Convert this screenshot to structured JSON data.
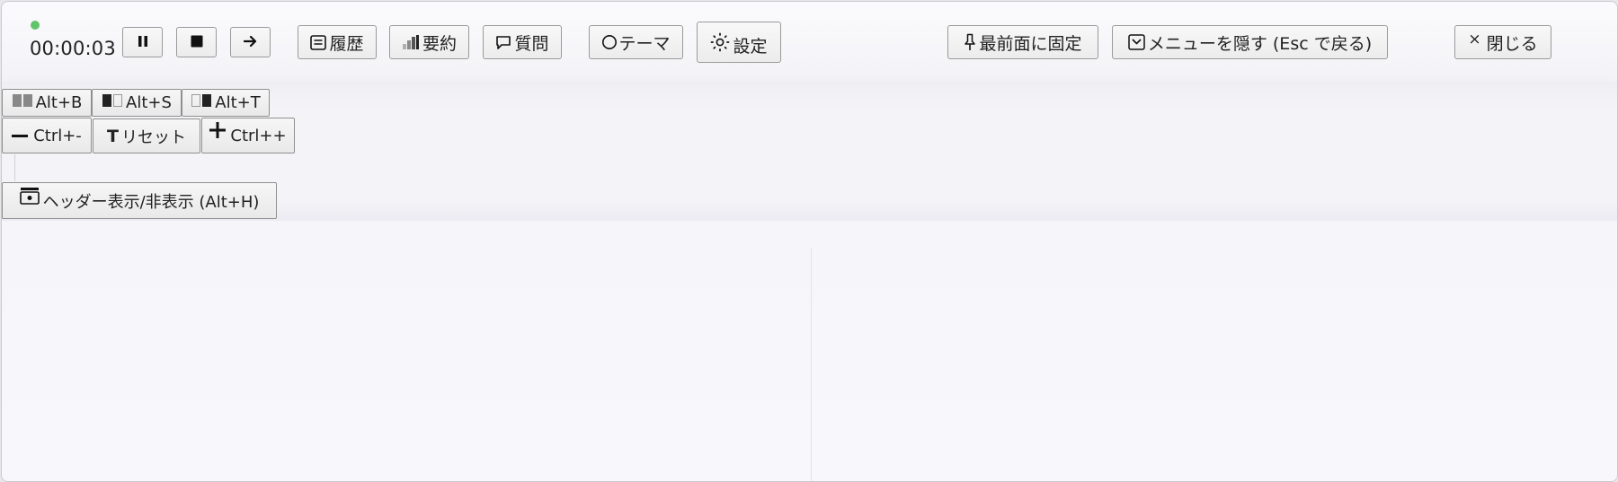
{
  "status": {
    "recording_color": "#5fc46a",
    "timer": "00:00:03"
  },
  "toolbar": {
    "pause_icon": "pause-icon",
    "stop_icon": "stop-icon",
    "forward_icon": "arrow-right-icon",
    "history_label": "履歴",
    "summary_label": "要約",
    "question_label": "質問",
    "theme_label": "テーマ",
    "settings_label": "設定",
    "pin_label": "最前面に固定",
    "hide_menu_label": "メニューを隠す (Esc で戻る)",
    "close_label": "閉じる",
    "close_glyph": "×"
  },
  "shortcuts": {
    "layout_both": "Alt+B",
    "layout_source": "Alt+S",
    "layout_translation": "Alt+T",
    "font_smaller": "Ctrl+-",
    "font_reset": "リセット",
    "font_reset_glyph": "T",
    "font_larger": "Ctrl++",
    "toggle_header": "ヘッダー表示/非表示 (Alt+H)"
  }
}
